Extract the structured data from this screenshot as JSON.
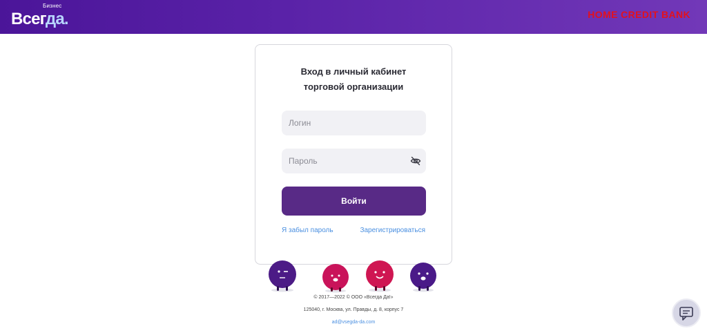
{
  "header": {
    "logo_sub": "Бизнес",
    "logo_main": "Всег",
    "logo_accent": "да.",
    "partner_logo": "HOME CREDIT BANK",
    "colors": {
      "gradient_start": "#4b1599",
      "gradient_end": "#7238b8",
      "partner_red": "#e3101d"
    }
  },
  "login": {
    "title_line1": "Вход в личный кабинет",
    "title_line2": "торговой организации",
    "login_placeholder": "Логин",
    "password_placeholder": "Пароль",
    "submit_label": "Войти",
    "forgot_label": "Я забыл пароль",
    "register_label": "Зарегистрироваться",
    "colors": {
      "button": "#582a86",
      "link": "#4a8fe0",
      "field_bg": "#f1f1f5"
    }
  },
  "footer": {
    "copyright": "© 2017—2022 © ООО «Всегда Да!»",
    "address": "125040, г. Москва, ул. Правды, д. 8, корпус 7",
    "email": "ad@vsegda-da.com"
  },
  "icons": {
    "eye_toggle": "eye-off-icon",
    "chat": "chat-icon"
  },
  "mascots": [
    "purple-mascot",
    "red-mascot",
    "red-mascot",
    "purple-mascot"
  ]
}
